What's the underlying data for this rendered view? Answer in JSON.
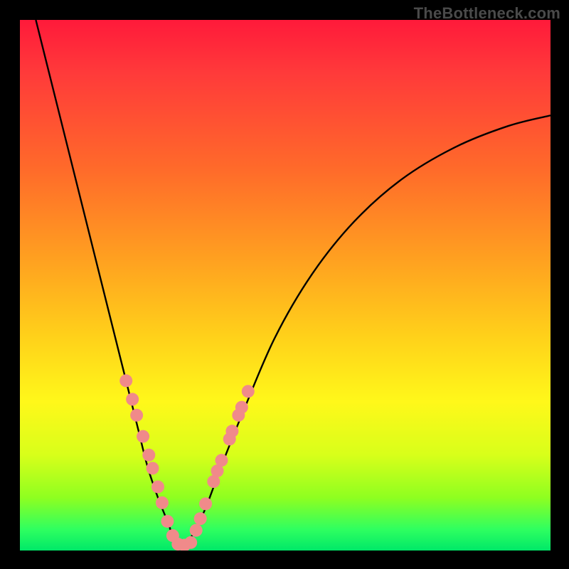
{
  "watermark": "TheBottleneck.com",
  "chart_data": {
    "type": "line",
    "title": "",
    "xlabel": "",
    "ylabel": "",
    "xlim": [
      0,
      100
    ],
    "ylim": [
      0,
      100
    ],
    "grid": false,
    "legend": false,
    "series": [
      {
        "name": "bottleneck-curve",
        "x": [
          3,
          6,
          10,
          14,
          18,
          22,
          24,
          26,
          28,
          29,
          30,
          31,
          32,
          33,
          35,
          38,
          42,
          48,
          55,
          63,
          72,
          82,
          92,
          100
        ],
        "y": [
          100,
          88,
          72,
          56,
          40,
          24,
          16,
          10,
          5,
          2,
          1,
          1,
          2,
          4,
          8,
          16,
          26,
          40,
          52,
          62,
          70,
          76,
          80,
          82
        ]
      }
    ],
    "markers": {
      "name": "highlight-dots",
      "color": "#f08a8a",
      "radius_px": 9,
      "points_xy": [
        [
          20.0,
          32.0
        ],
        [
          21.2,
          28.5
        ],
        [
          22.0,
          25.5
        ],
        [
          23.2,
          21.5
        ],
        [
          24.3,
          18.0
        ],
        [
          25.0,
          15.5
        ],
        [
          26.0,
          12.0
        ],
        [
          26.8,
          9.0
        ],
        [
          27.8,
          5.5
        ],
        [
          28.8,
          2.8
        ],
        [
          29.8,
          1.2
        ],
        [
          31.0,
          1.0
        ],
        [
          32.2,
          1.5
        ],
        [
          33.2,
          3.8
        ],
        [
          34.0,
          6.0
        ],
        [
          35.0,
          8.8
        ],
        [
          36.5,
          13.0
        ],
        [
          37.2,
          15.0
        ],
        [
          38.0,
          17.0
        ],
        [
          39.5,
          21.0
        ],
        [
          40.0,
          22.5
        ],
        [
          41.2,
          25.5
        ],
        [
          41.8,
          27.0
        ],
        [
          43.0,
          30.0
        ]
      ]
    },
    "gradient_stops": [
      {
        "pos": 0.0,
        "color": "#ff1a3a"
      },
      {
        "pos": 0.28,
        "color": "#ff6a2a"
      },
      {
        "pos": 0.6,
        "color": "#ffd21a"
      },
      {
        "pos": 0.82,
        "color": "#d8ff1a"
      },
      {
        "pos": 1.0,
        "color": "#00e868"
      }
    ]
  }
}
